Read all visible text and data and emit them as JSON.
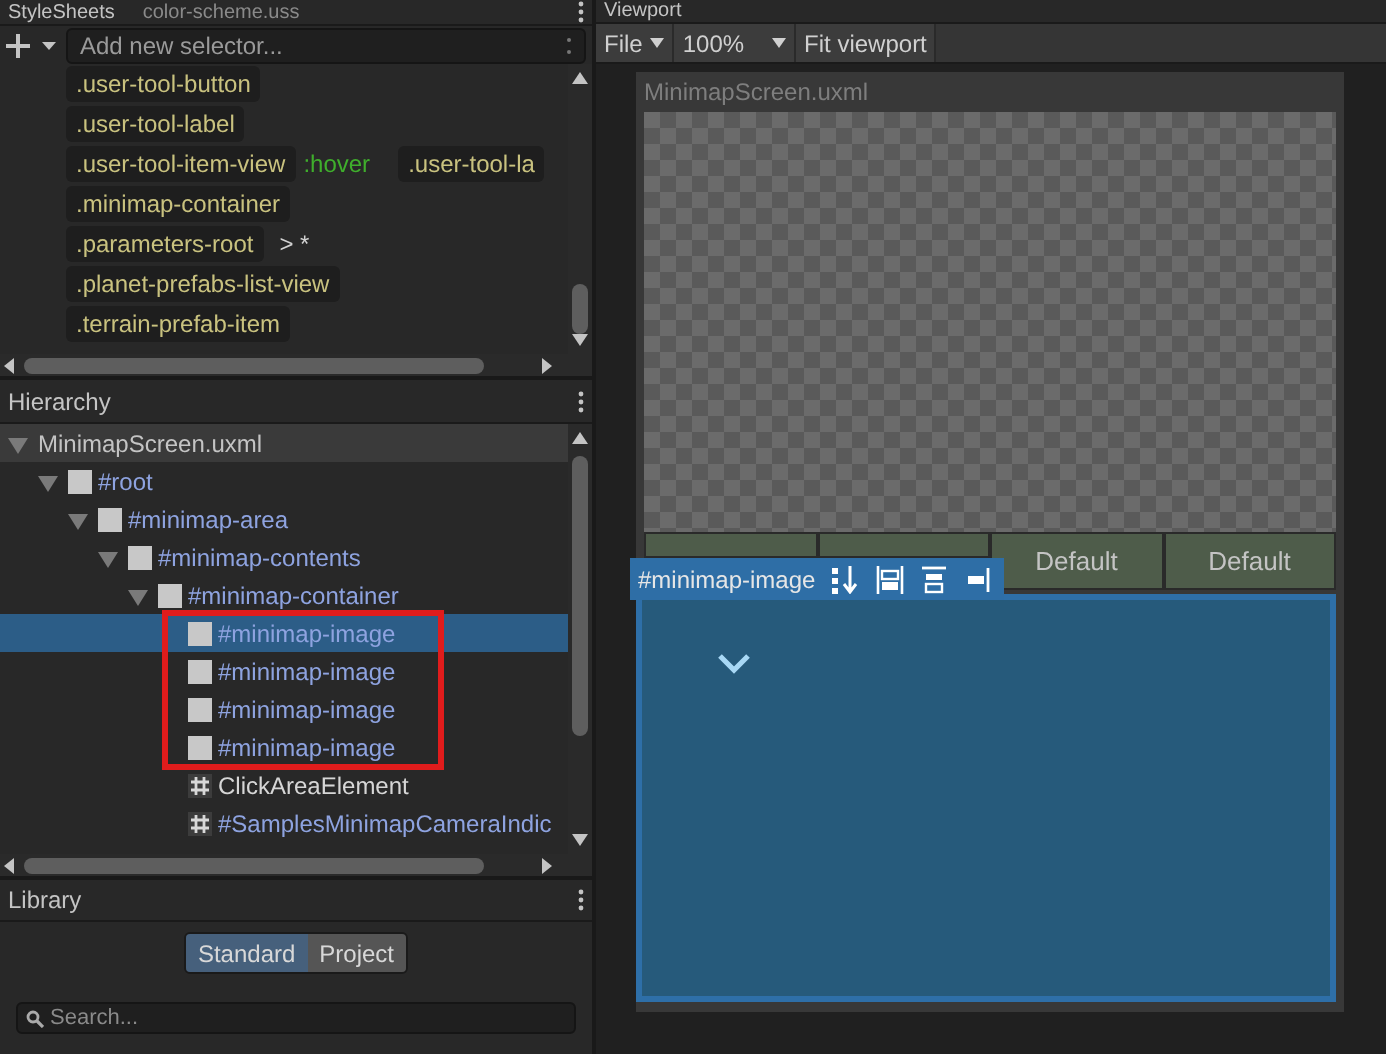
{
  "stylesheets": {
    "title": "StyleSheets",
    "file": "color-scheme.uss",
    "selector_placeholder": "Add new selector...",
    "selectors": [
      {
        "name": ".user-tool-button"
      },
      {
        "name": ".user-tool-label"
      },
      {
        "name": ".user-tool-item-view",
        "pseudo": ":hover",
        "extra": ".user-tool-la"
      },
      {
        "name": ".minimap-container"
      },
      {
        "name": ".parameters-root",
        "combinator": "> *"
      },
      {
        "name": ".planet-prefabs-list-view"
      },
      {
        "name": ".terrain-prefab-item"
      }
    ]
  },
  "hierarchy": {
    "title": "Hierarchy",
    "tree": [
      {
        "label": "MinimapScreen.uxml",
        "kind": "document",
        "expanded": true,
        "selected": false,
        "children": [
          {
            "label": "#root",
            "kind": "element",
            "expanded": true,
            "selected": false,
            "children": [
              {
                "label": "#minimap-area",
                "kind": "element",
                "expanded": true,
                "selected": false,
                "children": [
                  {
                    "label": "#minimap-contents",
                    "kind": "element",
                    "expanded": true,
                    "selected": false,
                    "children": [
                      {
                        "label": "#minimap-container",
                        "kind": "element",
                        "expanded": true,
                        "selected": false,
                        "children": [
                          {
                            "label": "#minimap-image",
                            "kind": "element",
                            "selected": true
                          },
                          {
                            "label": "#minimap-image",
                            "kind": "element",
                            "selected": false
                          },
                          {
                            "label": "#minimap-image",
                            "kind": "element",
                            "selected": false
                          },
                          {
                            "label": "#minimap-image",
                            "kind": "element",
                            "selected": false
                          },
                          {
                            "label": "ClickAreaElement",
                            "kind": "type",
                            "selected": false
                          },
                          {
                            "label": "#SamplesMinimapCameraIndic",
                            "kind": "instance",
                            "selected": false
                          }
                        ]
                      }
                    ]
                  }
                ]
              }
            ]
          }
        ]
      }
    ]
  },
  "library": {
    "title": "Library",
    "tabs": [
      {
        "label": "Standard",
        "selected": true
      },
      {
        "label": "Project",
        "selected": false
      }
    ],
    "search_placeholder": "Search..."
  },
  "viewport": {
    "title": "Viewport",
    "file_menu": "File",
    "zoom": "100%",
    "fit": "Fit viewport",
    "document_title": "MinimapScreen.uxml",
    "buttons": [
      {
        "kind": "blank"
      },
      {
        "kind": "blank"
      },
      {
        "kind": "labeled",
        "label": "Default"
      },
      {
        "kind": "labeled",
        "label": "Default"
      }
    ],
    "selection_tag": "#minimap-image"
  }
}
